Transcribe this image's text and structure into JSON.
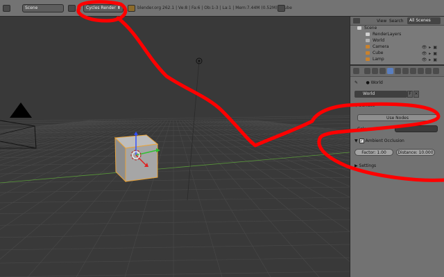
{
  "header": {
    "scene": "Scene",
    "render_engine": "Cycles Render",
    "stats": "blender.org 262.1 | Ve:8 | Fa:6 | Ob:1-3 | La:1 | Mem:7.44M (0.52M) | Cube"
  },
  "outliner": {
    "view_label": "View",
    "search_label": "Search",
    "scenes_dropdown": "All Scenes",
    "items": [
      {
        "label": "Scene"
      },
      {
        "label": "RenderLayers"
      },
      {
        "label": "World"
      },
      {
        "label": "Camera"
      },
      {
        "label": "Cube"
      },
      {
        "label": "Lamp"
      }
    ]
  },
  "properties": {
    "breadcrumb": "World",
    "world_field": "World",
    "world_fake": "F",
    "world_close": "×",
    "surface_label": "Surface",
    "use_nodes": "Use Nodes",
    "color_label": "Color:",
    "ambient_occlusion": "Ambient Occlusion",
    "factor": "Factor: 1.00",
    "distance": "Distance: 10.000",
    "settings": "Settings"
  },
  "colors": {
    "background": "#393939",
    "grid": "#4a4a4a",
    "x_axis": "#5a9a3a",
    "scribble": "#ff0000",
    "cube_outline": "#e8a33a"
  }
}
